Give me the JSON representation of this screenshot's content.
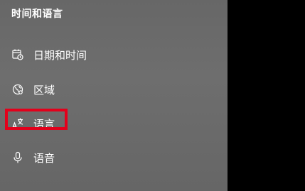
{
  "section": {
    "title": "时间和语言"
  },
  "nav": {
    "items": [
      {
        "label": "日期和时间",
        "icon": "calendar-clock-icon"
      },
      {
        "label": "区域",
        "icon": "globe-region-icon"
      },
      {
        "label": "语言",
        "icon": "language-icon"
      },
      {
        "label": "语音",
        "icon": "microphone-icon"
      }
    ],
    "highlighted_index": 2
  },
  "colors": {
    "sidebar_bg": "#6b6b6b",
    "text": "#ffffff",
    "highlight": "#e3001b",
    "right_pane_bg": "#000000"
  }
}
